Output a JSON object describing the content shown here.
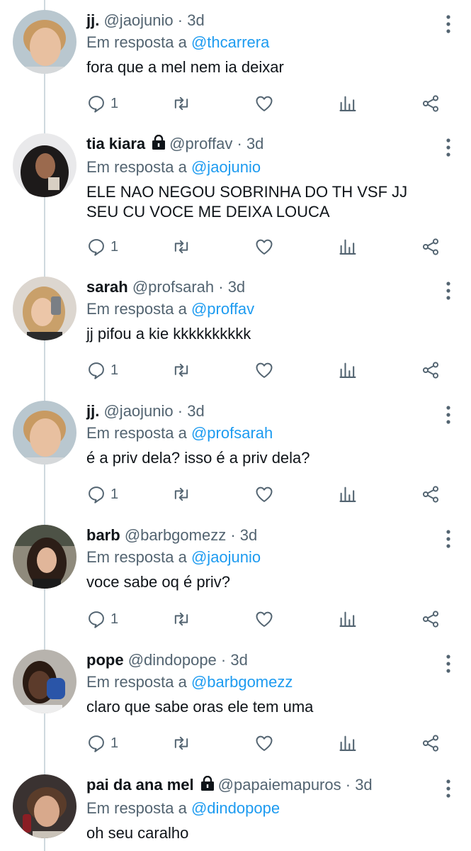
{
  "tweets": [
    {
      "name": "jj.",
      "handle": "@jaojunio",
      "time": "3d",
      "reply_prefix": "Em resposta a",
      "reply_to": "@thcarrera",
      "text": "fora que a mel nem ia deixar",
      "replies": "1",
      "locked": false
    },
    {
      "name": "tia kiara",
      "handle": "@proffav",
      "time": "3d",
      "reply_prefix": "Em resposta a",
      "reply_to": "@jaojunio",
      "text": "ELE NAO NEGOU SOBRINHA DO TH VSF JJ SEU CU VOCE ME DEIXA LOUCA",
      "replies": "1",
      "locked": true
    },
    {
      "name": "sarah",
      "handle": "@profsarah",
      "time": "3d",
      "reply_prefix": "Em resposta a",
      "reply_to": "@proffav",
      "text": "jj pifou a kie kkkkkkkkkk",
      "replies": "1",
      "locked": false
    },
    {
      "name": "jj.",
      "handle": "@jaojunio",
      "time": "3d",
      "reply_prefix": "Em resposta a",
      "reply_to": "@profsarah",
      "text": "é a priv dela? isso é a priv dela?",
      "replies": "1",
      "locked": false
    },
    {
      "name": "barb",
      "handle": "@barbgomezz",
      "time": "3d",
      "reply_prefix": "Em resposta a",
      "reply_to": "@jaojunio",
      "text": "voce sabe oq é priv?",
      "replies": "1",
      "locked": false
    },
    {
      "name": "pope",
      "handle": "@dindopope",
      "time": "3d",
      "reply_prefix": "Em resposta a",
      "reply_to": "@barbgomezz",
      "text": "claro que sabe oras ele tem uma",
      "replies": "1",
      "locked": false
    },
    {
      "name": "pai da ana mel",
      "handle": "@papaiemapuros",
      "time": "3d",
      "reply_prefix": "Em resposta a",
      "reply_to": "@dindopope",
      "text": "oh seu caralho",
      "replies": "",
      "locked": true
    }
  ],
  "icons": {
    "reply": "reply-icon",
    "retweet": "retweet-icon",
    "like": "heart-icon",
    "analytics": "analytics-icon",
    "share": "share-icon",
    "more": "more-options-icon",
    "lock": "lock-icon"
  },
  "colors": {
    "mention": "#1d9bf0",
    "secondary": "#536471",
    "thread_line": "#cfd9de"
  }
}
